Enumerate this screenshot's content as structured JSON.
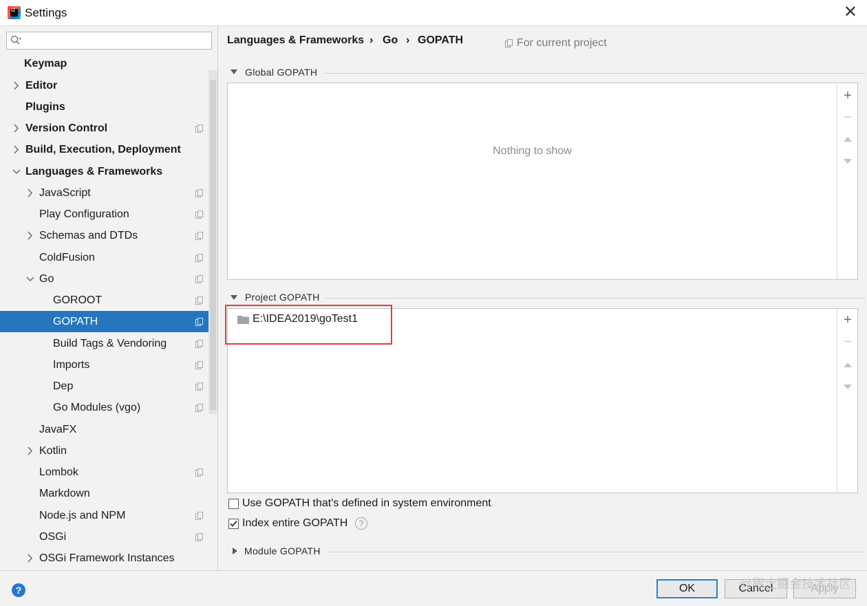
{
  "window": {
    "title": "Settings",
    "close_glyph": "✕"
  },
  "sidebar": {
    "search_placeholder": "",
    "items": [
      {
        "label": "Keymap",
        "bold": true,
        "arrow": "none",
        "indent": 0,
        "copy_icon": false
      },
      {
        "label": "Editor",
        "bold": true,
        "arrow": "right",
        "indent": 0,
        "copy_icon": false
      },
      {
        "label": "Plugins",
        "bold": true,
        "arrow": "none",
        "indent": 0,
        "copy_icon": false
      },
      {
        "label": "Version Control",
        "bold": true,
        "arrow": "right",
        "indent": 0,
        "copy_icon": true
      },
      {
        "label": "Build, Execution, Deployment",
        "bold": true,
        "arrow": "right",
        "indent": 0,
        "copy_icon": false
      },
      {
        "label": "Languages & Frameworks",
        "bold": true,
        "arrow": "down",
        "indent": 0,
        "copy_icon": false
      },
      {
        "label": "JavaScript",
        "bold": false,
        "arrow": "right",
        "indent": 1,
        "copy_icon": true
      },
      {
        "label": "Play Configuration",
        "bold": false,
        "arrow": "none",
        "indent": 1,
        "copy_icon": true
      },
      {
        "label": "Schemas and DTDs",
        "bold": false,
        "arrow": "right",
        "indent": 1,
        "copy_icon": true
      },
      {
        "label": "ColdFusion",
        "bold": false,
        "arrow": "none",
        "indent": 1,
        "copy_icon": true
      },
      {
        "label": "Go",
        "bold": false,
        "arrow": "down",
        "indent": 1,
        "copy_icon": true
      },
      {
        "label": "GOROOT",
        "bold": false,
        "arrow": "none",
        "indent": 2,
        "copy_icon": true
      },
      {
        "label": "GOPATH",
        "bold": false,
        "arrow": "none",
        "indent": 2,
        "copy_icon": true,
        "selected": true
      },
      {
        "label": "Build Tags & Vendoring",
        "bold": false,
        "arrow": "none",
        "indent": 2,
        "copy_icon": true
      },
      {
        "label": "Imports",
        "bold": false,
        "arrow": "none",
        "indent": 2,
        "copy_icon": true
      },
      {
        "label": "Dep",
        "bold": false,
        "arrow": "none",
        "indent": 2,
        "copy_icon": true
      },
      {
        "label": "Go Modules (vgo)",
        "bold": false,
        "arrow": "none",
        "indent": 2,
        "copy_icon": true
      },
      {
        "label": "JavaFX",
        "bold": false,
        "arrow": "none",
        "indent": 1,
        "copy_icon": false
      },
      {
        "label": "Kotlin",
        "bold": false,
        "arrow": "right",
        "indent": 1,
        "copy_icon": false
      },
      {
        "label": "Lombok",
        "bold": false,
        "arrow": "none",
        "indent": 1,
        "copy_icon": true
      },
      {
        "label": "Markdown",
        "bold": false,
        "arrow": "none",
        "indent": 1,
        "copy_icon": false
      },
      {
        "label": "Node.js and NPM",
        "bold": false,
        "arrow": "none",
        "indent": 1,
        "copy_icon": true
      },
      {
        "label": "OSGi",
        "bold": false,
        "arrow": "none",
        "indent": 1,
        "copy_icon": true
      },
      {
        "label": "OSGi Framework Instances",
        "bold": false,
        "arrow": "right",
        "indent": 1,
        "copy_icon": false
      }
    ]
  },
  "breadcrumb": {
    "items": [
      "Languages & Frameworks",
      "Go",
      "GOPATH"
    ],
    "separator": "›",
    "scope_note": "For current project"
  },
  "global_gopath": {
    "title": "Global GOPATH",
    "empty_text": "Nothing to show"
  },
  "project_gopath": {
    "title": "Project GOPATH",
    "entries": [
      "E:\\IDEA2019\\goTest1"
    ]
  },
  "toolbar": {
    "add": "+",
    "remove": "−"
  },
  "options": {
    "use_system_gopath": {
      "label": "Use GOPATH that's defined in system environment",
      "checked": false
    },
    "index_entire_gopath": {
      "label": "Index entire GOPATH",
      "checked": true,
      "help": "?"
    }
  },
  "module_gopath": {
    "title": "Module GOPATH"
  },
  "footer": {
    "help": "?",
    "ok": "OK",
    "cancel": "Cancel",
    "apply": "Apply",
    "watermark": "@稀土掘金技术社区"
  },
  "colors": {
    "selection": "#2675bf",
    "highlight_box": "#e53b3b",
    "accent": "#2a7fd6"
  }
}
